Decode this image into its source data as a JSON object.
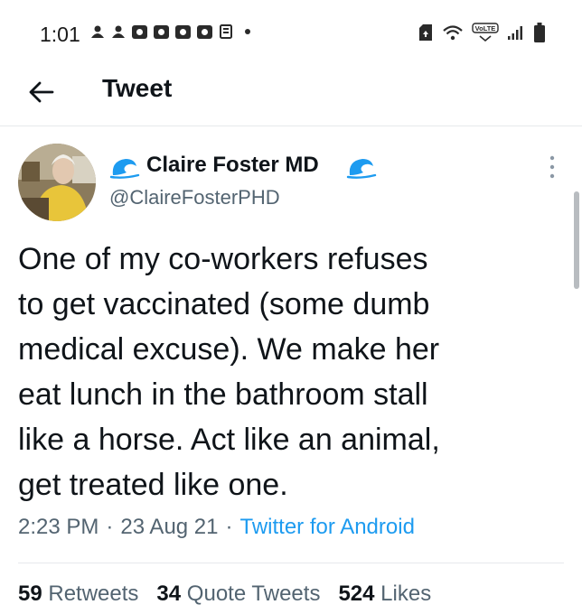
{
  "status_bar": {
    "time": "1:01",
    "left_icons": [
      "notification-icon",
      "notification-icon",
      "app-icon",
      "app-icon",
      "app-icon",
      "app-icon",
      "news-icon",
      "dot-icon"
    ],
    "right_icons": [
      "sim-icon",
      "wifi-icon",
      "volte-icon",
      "signal-icon",
      "battery-icon"
    ],
    "volte_label": "VoLTE"
  },
  "header": {
    "title": "Tweet"
  },
  "author": {
    "name": "Claire Foster MD",
    "handle": "@ClaireFosterPHD",
    "badge_color": "#1d9bf0"
  },
  "tweet": {
    "text": "One of my co-workers refuses\nto get vaccinated (some dumb\nmedical excuse).  We make her\neat lunch in the bathroom stall\nlike a horse. Act like an animal,\nget treated like one.",
    "time": "2:23 PM",
    "date": "23 Aug 21",
    "separator": "·",
    "source": "Twitter for Android"
  },
  "stats": {
    "retweets_count": "59",
    "retweets_label": "Retweets",
    "quotes_count": "34",
    "quotes_label": "Quote Tweets",
    "likes_count": "524",
    "likes_label": "Likes"
  },
  "colors": {
    "accent": "#1d9bf0",
    "text_primary": "#0f1419",
    "text_secondary": "#536471"
  }
}
